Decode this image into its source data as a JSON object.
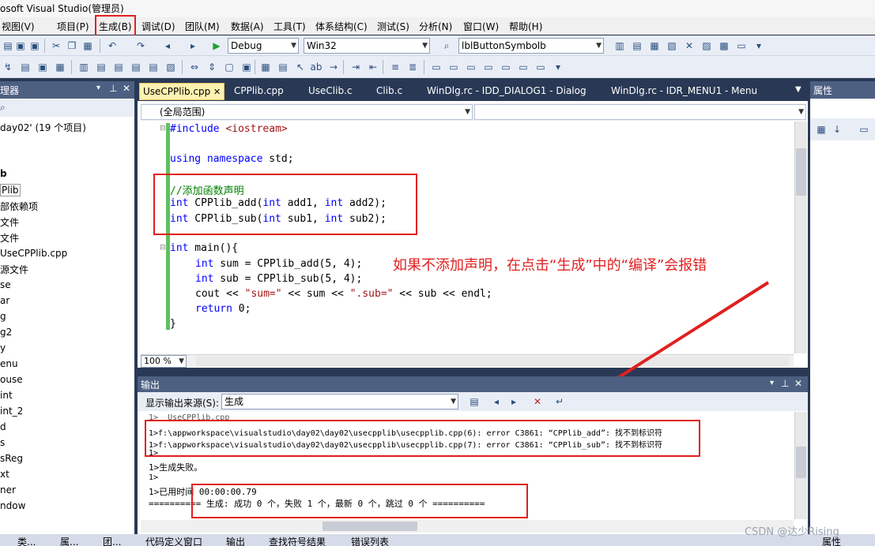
{
  "app": {
    "title": "osoft Visual Studio(管理员)"
  },
  "menu": [
    "视图(V)",
    "项目(P)",
    "生成(B)",
    "调试(D)",
    "团队(M)",
    "数据(A)",
    "工具(T)",
    "体系结构(C)",
    "测试(S)",
    "分析(N)",
    "窗口(W)",
    "帮助(H)"
  ],
  "toolbar": {
    "config": "Debug",
    "platform": "Win32",
    "symbol": "lblButtonSymbolb"
  },
  "left_panel": {
    "title": "理器",
    "items": [
      "day02' (19 个项目)",
      "b",
      "Plib",
      "部依赖项",
      "文件",
      "文件",
      "UseCPPlib.cpp",
      "源文件",
      "se",
      "ar",
      "g",
      "g2",
      "y",
      "enu",
      "ouse",
      "int",
      "int_2",
      "d",
      "s",
      "sReg",
      "xt",
      "ner",
      "ndow"
    ]
  },
  "right_panel": {
    "title": "属性"
  },
  "doc_tabs": [
    "UseCPPlib.cpp",
    "CPPlib.cpp",
    "UseClib.c",
    "Clib.c",
    "WinDlg.rc - IDD_DIALOG1 - Dialog",
    "WinDlg.rc - IDR_MENU1 - Menu"
  ],
  "editor": {
    "scope": "(全局范围)",
    "zoom": "100 %",
    "code": {
      "l1": "#include",
      "l1b": " <iostream>",
      "l2a": "using namespace",
      "l2b": " std;",
      "l3": "//添加函数声明",
      "l4a": "int",
      "l4b": " CPPlib_add(",
      "l4c": "int",
      "l4d": " add1, ",
      "l4e": "int",
      "l4f": " add2);",
      "l5a": "int",
      "l5b": " CPPlib_sub(",
      "l5c": "int",
      "l5d": " sub1, ",
      "l5e": "int",
      "l5f": " sub2);",
      "l6a": "int",
      "l6b": " main(){",
      "l7a": "int",
      "l7b": " sum = CPPlib_add(5, 4);",
      "l8a": "int",
      "l8b": " sub = CPPlib_sub(5, 4);",
      "l9a": "cout << ",
      "l9b": "\"sum=\"",
      "l9c": " << sum << ",
      "l9d": "\".sub=\"",
      "l9e": " << sub << endl;",
      "l10a": "return",
      "l10b": " 0;",
      "l11": "}"
    },
    "annotation": "如果不添加声明，在点击“生成”中的“编译”会报错"
  },
  "output": {
    "title": "输出",
    "source_label": "显示输出来源(S):",
    "source_value": "生成",
    "lines": [
      "1>  UseCPPlib.cpp",
      "1>f:\\appworkspace\\visualstudio\\day02\\day02\\usecpplib\\usecpplib.cpp(6): error C3861: “CPPlib_add”: 找不到标识符",
      "1>f:\\appworkspace\\visualstudio\\day02\\day02\\usecpplib\\usecpplib.cpp(7): error C3861: “CPPlib_sub”: 找不到标识符",
      "1>",
      "1>生成失败。",
      "1>",
      "1>已用时间 00:00:00.79",
      "========== 生成: 成功 0 个，失败 1 个，最新 0 个，跳过 0 个 =========="
    ]
  },
  "statusbar": [
    "类...",
    "属...",
    "团...",
    "代码定义窗口",
    "输出",
    "查找符号结果",
    "错误列表"
  ],
  "watermark": "CSDN @达少Rising",
  "right_status": "属性"
}
